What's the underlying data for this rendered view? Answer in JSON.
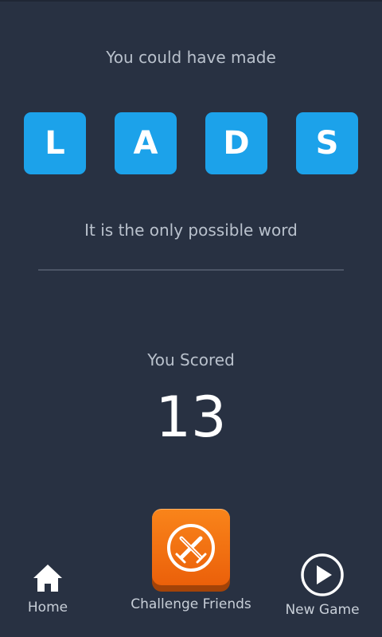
{
  "message": {
    "could_have": "You could have made",
    "only_word": "It is the only possible word"
  },
  "tiles": [
    "L",
    "A",
    "D",
    "S"
  ],
  "score": {
    "label": "You Scored",
    "value": "13"
  },
  "nav": {
    "home": {
      "label": "Home",
      "icon": "home-icon"
    },
    "challenge": {
      "label": "Challenge Friends",
      "icon": "crossed-swords-icon"
    },
    "new_game": {
      "label": "New Game",
      "icon": "play-circle-icon"
    }
  },
  "colors": {
    "background": "#283142",
    "tile": "#1ca2ea",
    "challenge_button": "#f47212",
    "muted_text": "#b9c1cc"
  }
}
